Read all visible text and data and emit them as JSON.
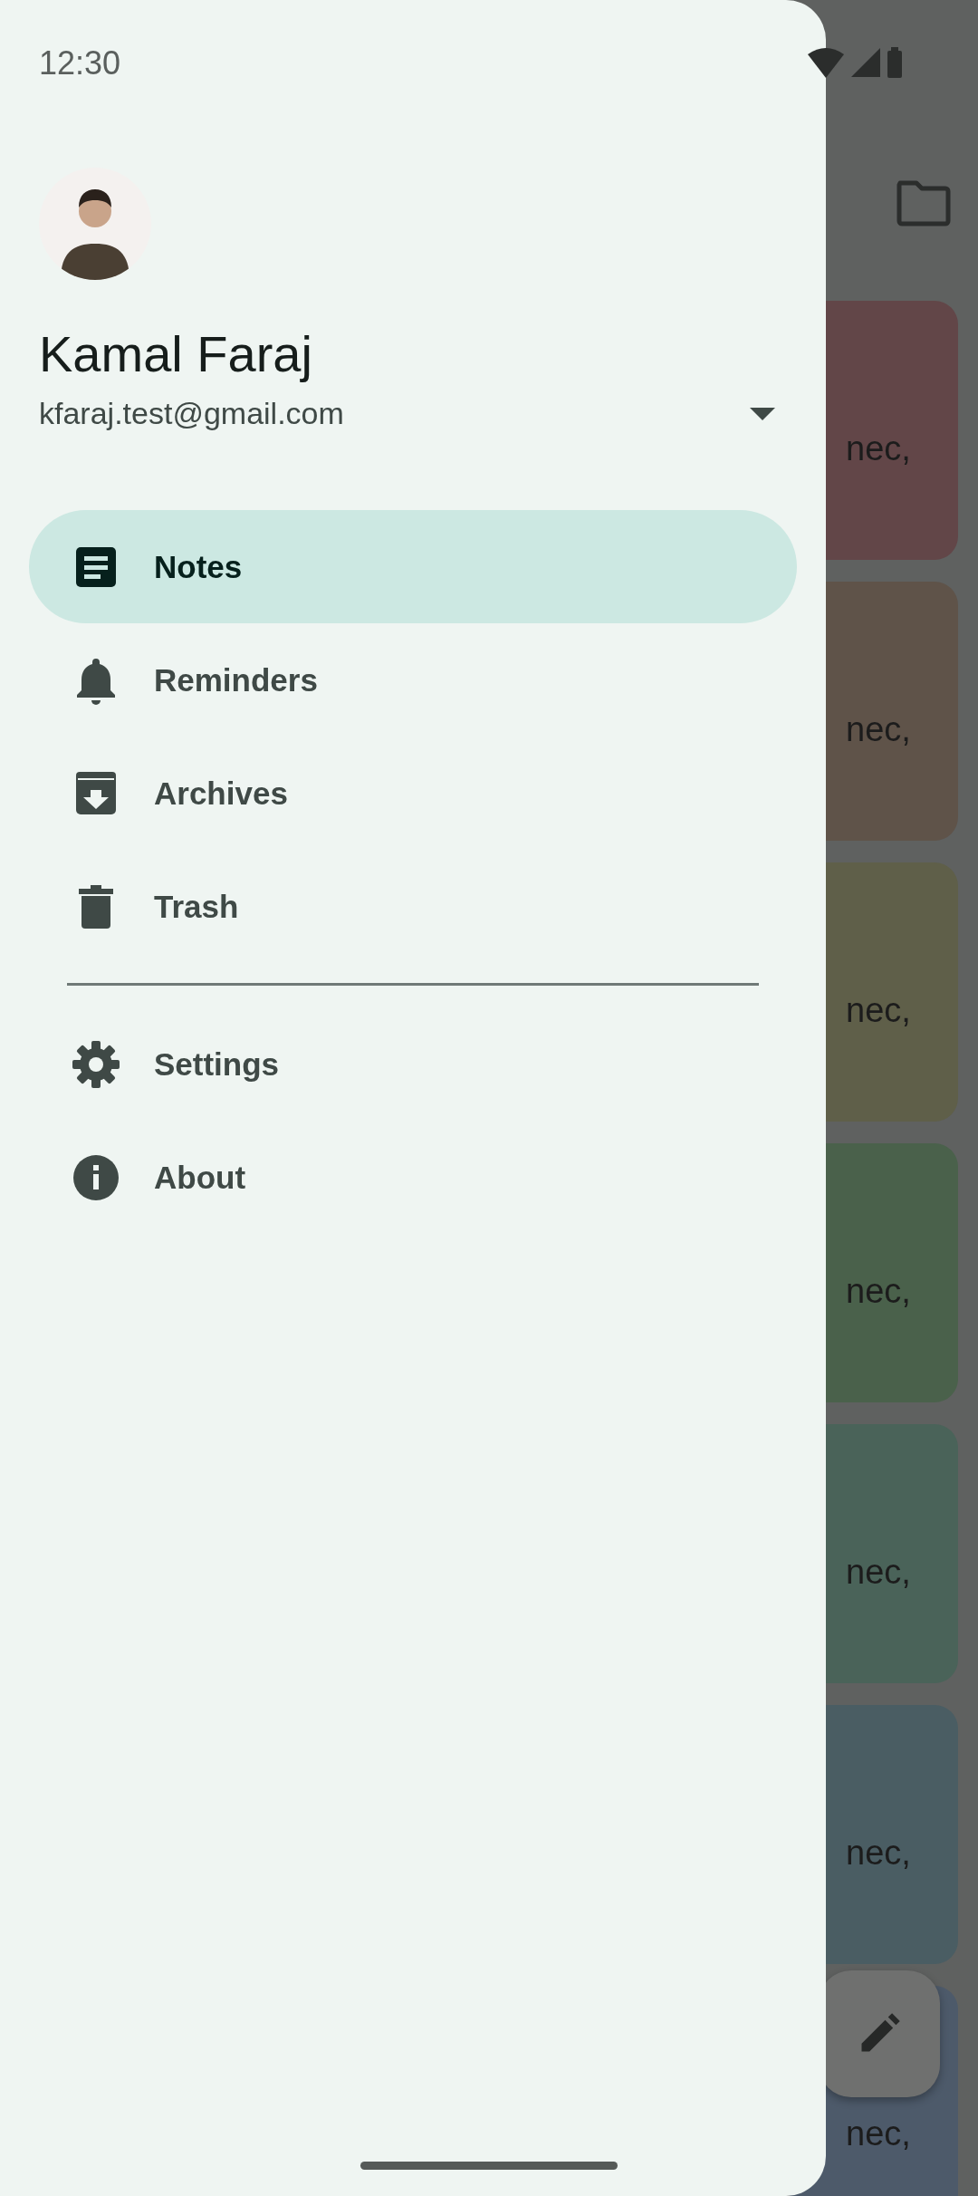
{
  "status_bar": {
    "time": "12:30"
  },
  "account": {
    "name": "Kamal Faraj",
    "email": "kfaraj.test@gmail.com"
  },
  "menu": {
    "primary_items": [
      {
        "kind": "notes",
        "label": "Notes",
        "selected": true
      },
      {
        "kind": "reminders",
        "label": "Reminders",
        "selected": false
      },
      {
        "kind": "archives",
        "label": "Archives",
        "selected": false
      },
      {
        "kind": "trash",
        "label": "Trash",
        "selected": false
      }
    ],
    "secondary_items": [
      {
        "kind": "settings",
        "label": "Settings",
        "selected": false
      },
      {
        "kind": "about",
        "label": "About",
        "selected": false
      }
    ]
  },
  "notes": [
    {
      "text": "nec,",
      "color": "#624648"
    },
    {
      "text": "nec,",
      "color": "#5f5349"
    },
    {
      "text": "nec,",
      "color": "#5f5f49"
    },
    {
      "text": "nec,",
      "color": "#4a614b"
    },
    {
      "text": "nec,",
      "color": "#4a6359"
    },
    {
      "text": "nec,",
      "color": "#4a5d63"
    },
    {
      "text": "nec,",
      "color": "#4d5a6a"
    }
  ]
}
